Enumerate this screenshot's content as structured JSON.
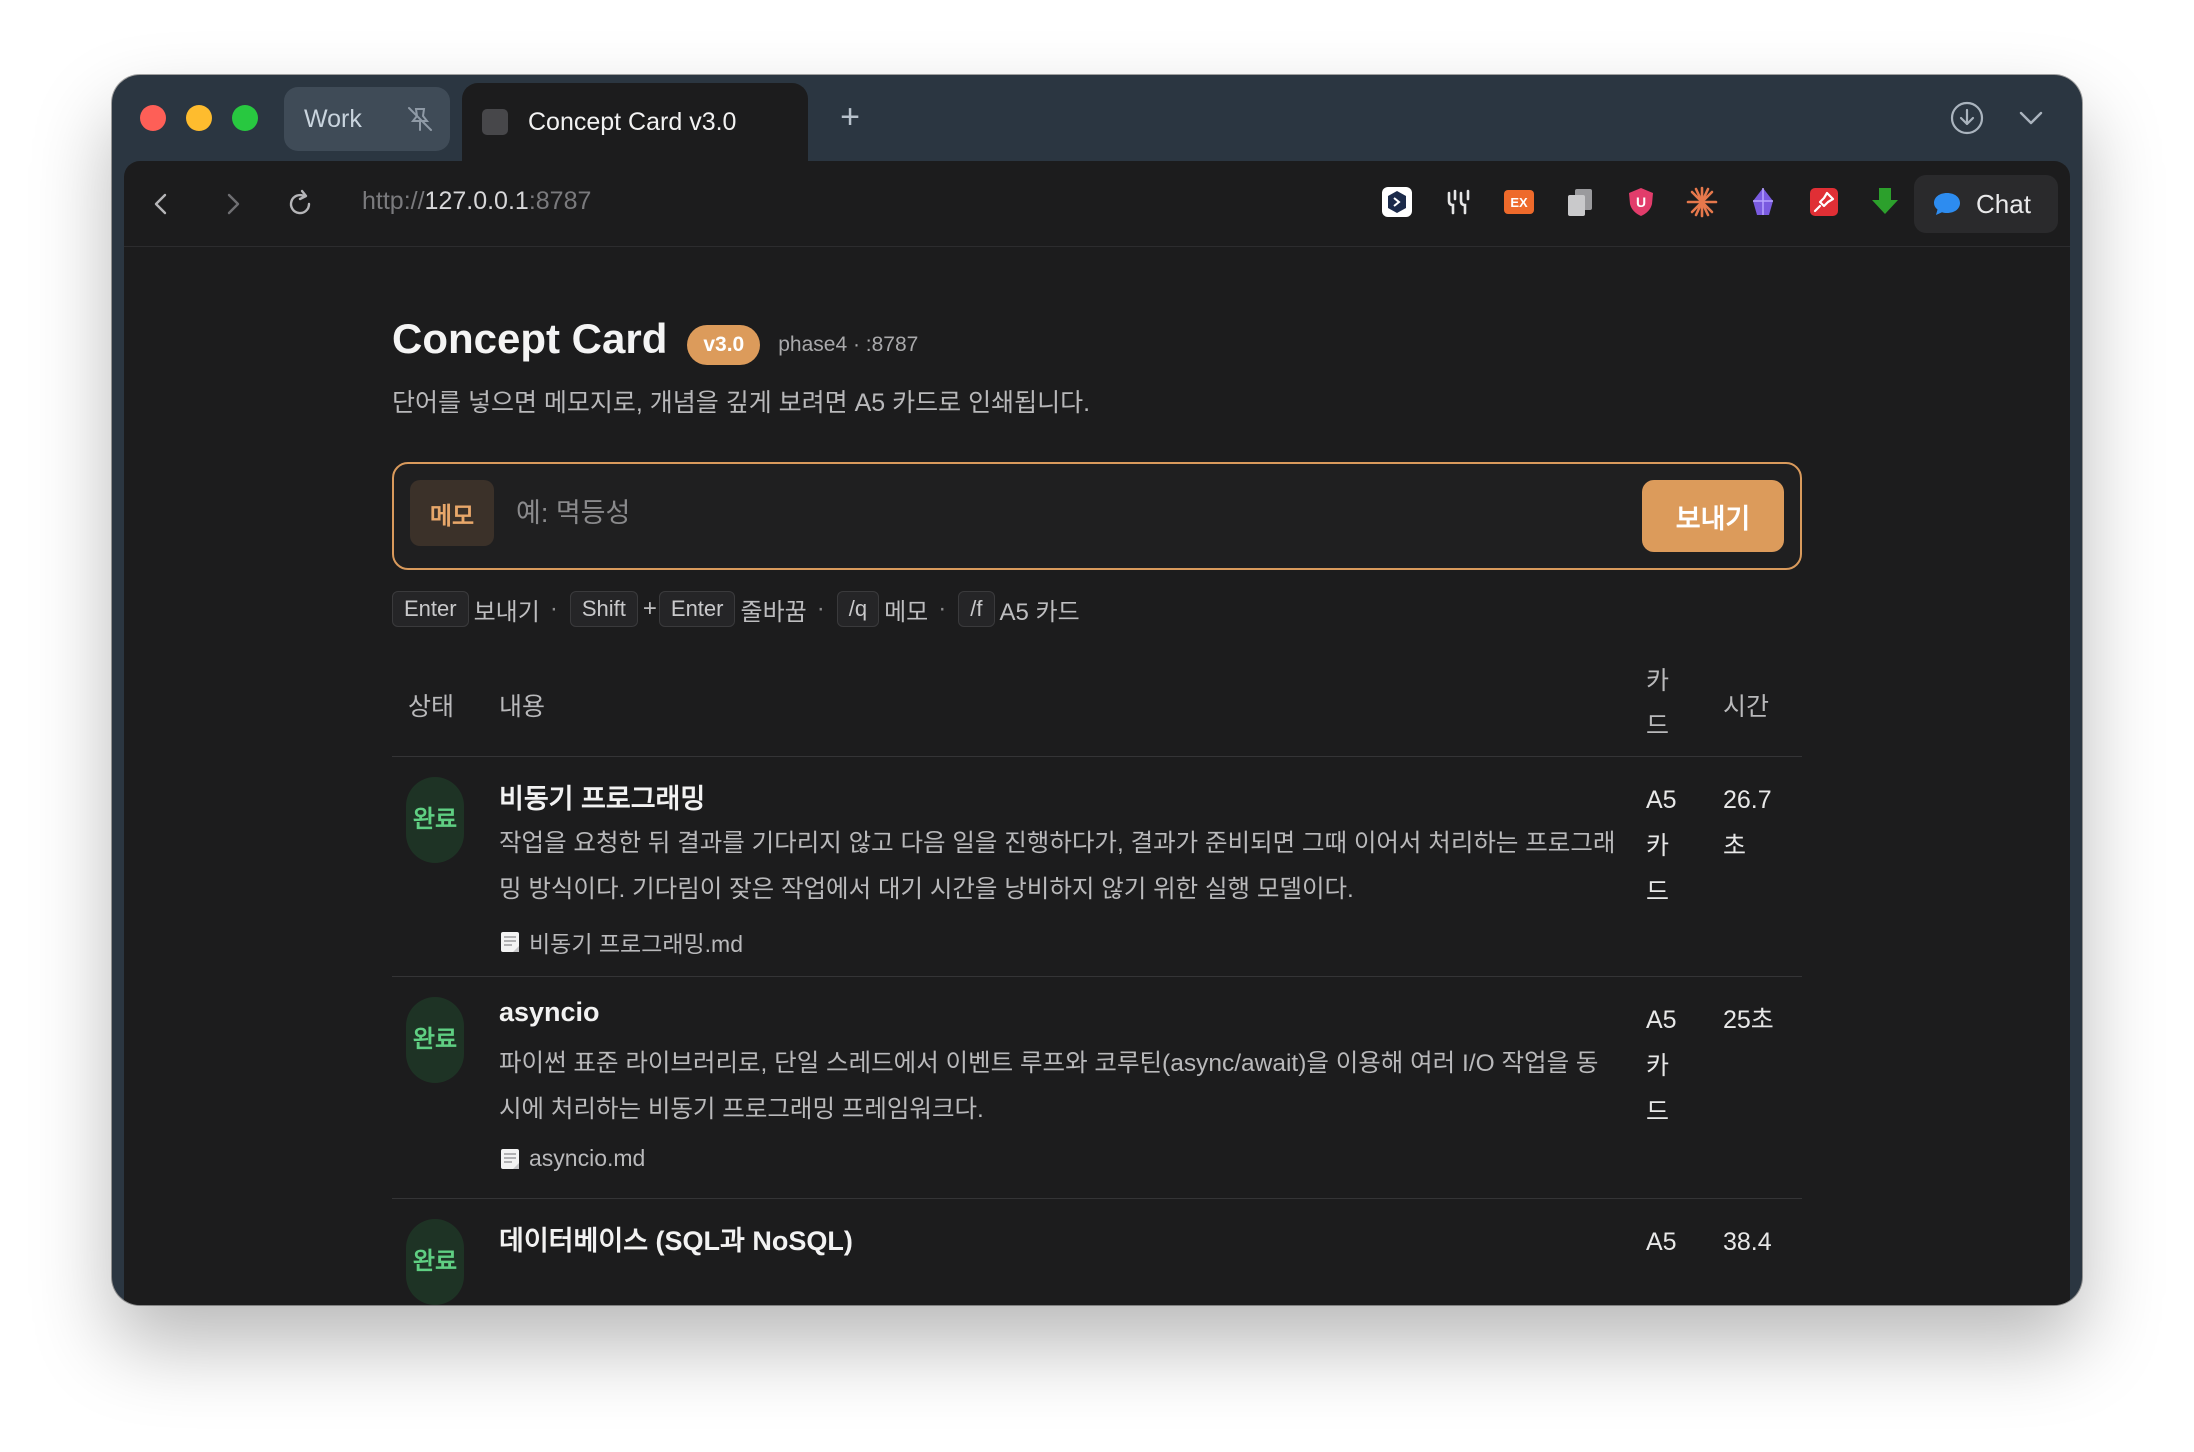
{
  "browser": {
    "tab_group_label": "Work",
    "active_tab_title": "Concept Card v3.0",
    "new_tab_symbol": "+",
    "url_scheme": "http://",
    "url_host": "127.0.0.1",
    "url_port": ":8787",
    "chat_label": "Chat",
    "extensions": [
      "hexagon-code-icon",
      "fork-logo-icon",
      "ex-badge-icon",
      "copy-pages-icon",
      "shield-u-icon",
      "orange-burst-icon",
      "purple-crystal-icon",
      "red-pin-icon",
      "green-download-arrow-icon"
    ]
  },
  "header": {
    "title": "Concept Card",
    "version": "v3.0",
    "phase": "phase4 · :8787",
    "subtitle": "단어를 넣으면 메모지로, 개념을 깊게 보려면 A5 카드로 인쇄됩니다."
  },
  "composer": {
    "mode": "메모",
    "placeholder": "예: 멱등성",
    "value": "",
    "send_label": "보내기"
  },
  "hints": {
    "enter": "Enter",
    "send": "보내기",
    "shift": "Shift",
    "plus": "+",
    "enter2": "Enter",
    "newline": "줄바꿈",
    "q": "/q",
    "memo": "메모",
    "f": "/f",
    "a5": "A5 카드",
    "dot": "·"
  },
  "table": {
    "columns": {
      "status": "상태",
      "content": "내용",
      "card": "카드",
      "time": "시간"
    },
    "rows": [
      {
        "status": "완료",
        "title": "비동기 프로그래밍",
        "description": "작업을 요청한 뒤 결과를 기다리지 않고 다음 일을 진행하다가, 결과가 준비되면 그때 이어서 처리하는 프로그래밍 방식이다. 기다림이 잦은 작업에서 대기 시간을 낭비하지 않기 위한 실행 모델이다.",
        "file": "비동기 프로그래밍.md",
        "card": "A5 카드",
        "time": "26.7초"
      },
      {
        "status": "완료",
        "title": "asyncio",
        "description": "파이썬 표준 라이브러리로, 단일 스레드에서 이벤트 루프와 코루틴(async/await)을 이용해 여러 I/O 작업을 동시에 처리하는 비동기 프로그래밍 프레임워크다.",
        "file": "asyncio.md",
        "card": "A5 카드",
        "time": "25초"
      },
      {
        "status": "완료",
        "title": "데이터베이스 (SQL과 NoSQL)",
        "description": "",
        "file": "",
        "card": "A5",
        "time": "38.4"
      }
    ]
  }
}
